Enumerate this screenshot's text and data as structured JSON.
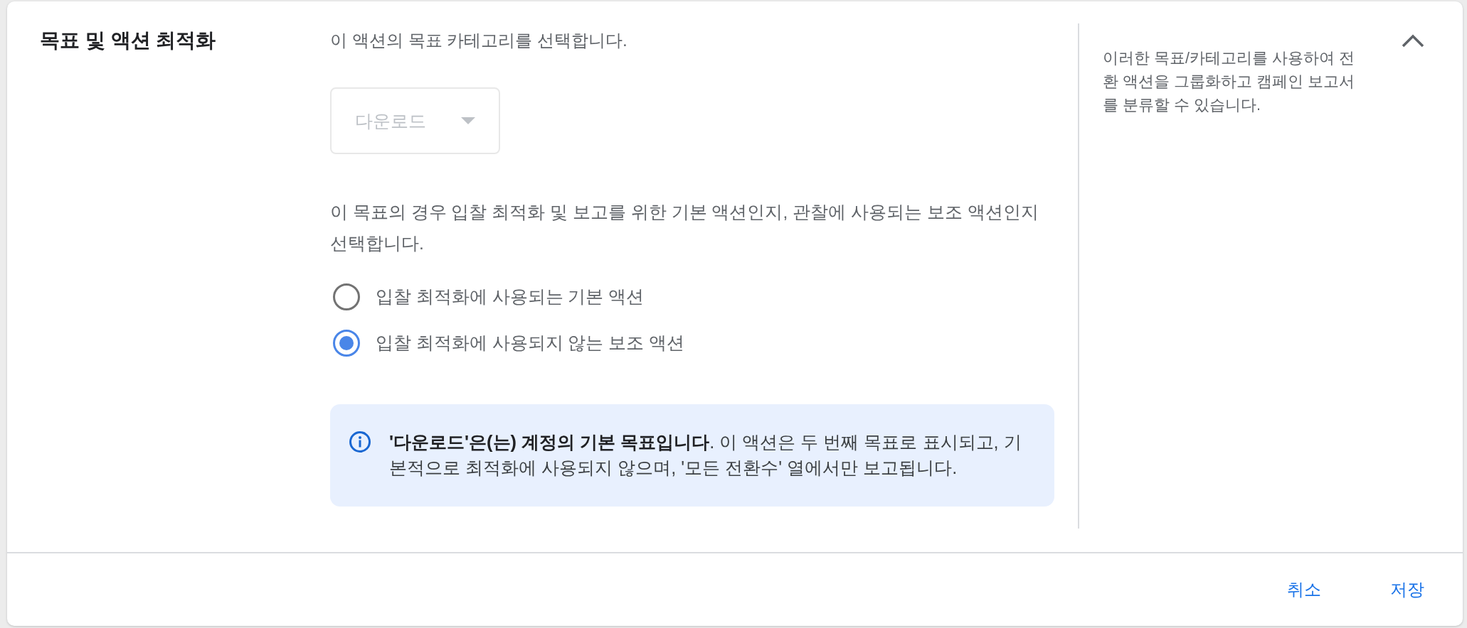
{
  "section": {
    "title": "목표 및 액션 최적화",
    "expanded": true
  },
  "category": {
    "prompt": "이 액션의 목표 카테고리를 선택합니다.",
    "dropdown": {
      "value": "다운로드",
      "disabled": true
    }
  },
  "action_type": {
    "prompt": "이 목표의 경우 입찰 최적화 및 보고를 위한 기본 액션인지, 관찰에 사용되는 보조 액션인지 선택합니다.",
    "options": [
      {
        "label": "입찰 최적화에 사용되는 기본 액션",
        "selected": false
      },
      {
        "label": "입찰 최적화에 사용되지 않는 보조 액션",
        "selected": true
      }
    ]
  },
  "info": {
    "text": "**'다운로드'은(는) 계정의 기본 목표입니다**. 이 액션은 두 번째 목표로 표시되고, 기본적으로 최적화에 사용되지 않으며, '모든 전환수' 열에서만 보고됩니다."
  },
  "help": {
    "text": "이러한 목표/카테고리를 사용하여 전환 액션을 그룹화하고 캠페인 보고서를 분류할 수 있습니다."
  },
  "buttons": [
    {
      "label": "취소"
    },
    {
      "label": "저장"
    }
  ]
}
